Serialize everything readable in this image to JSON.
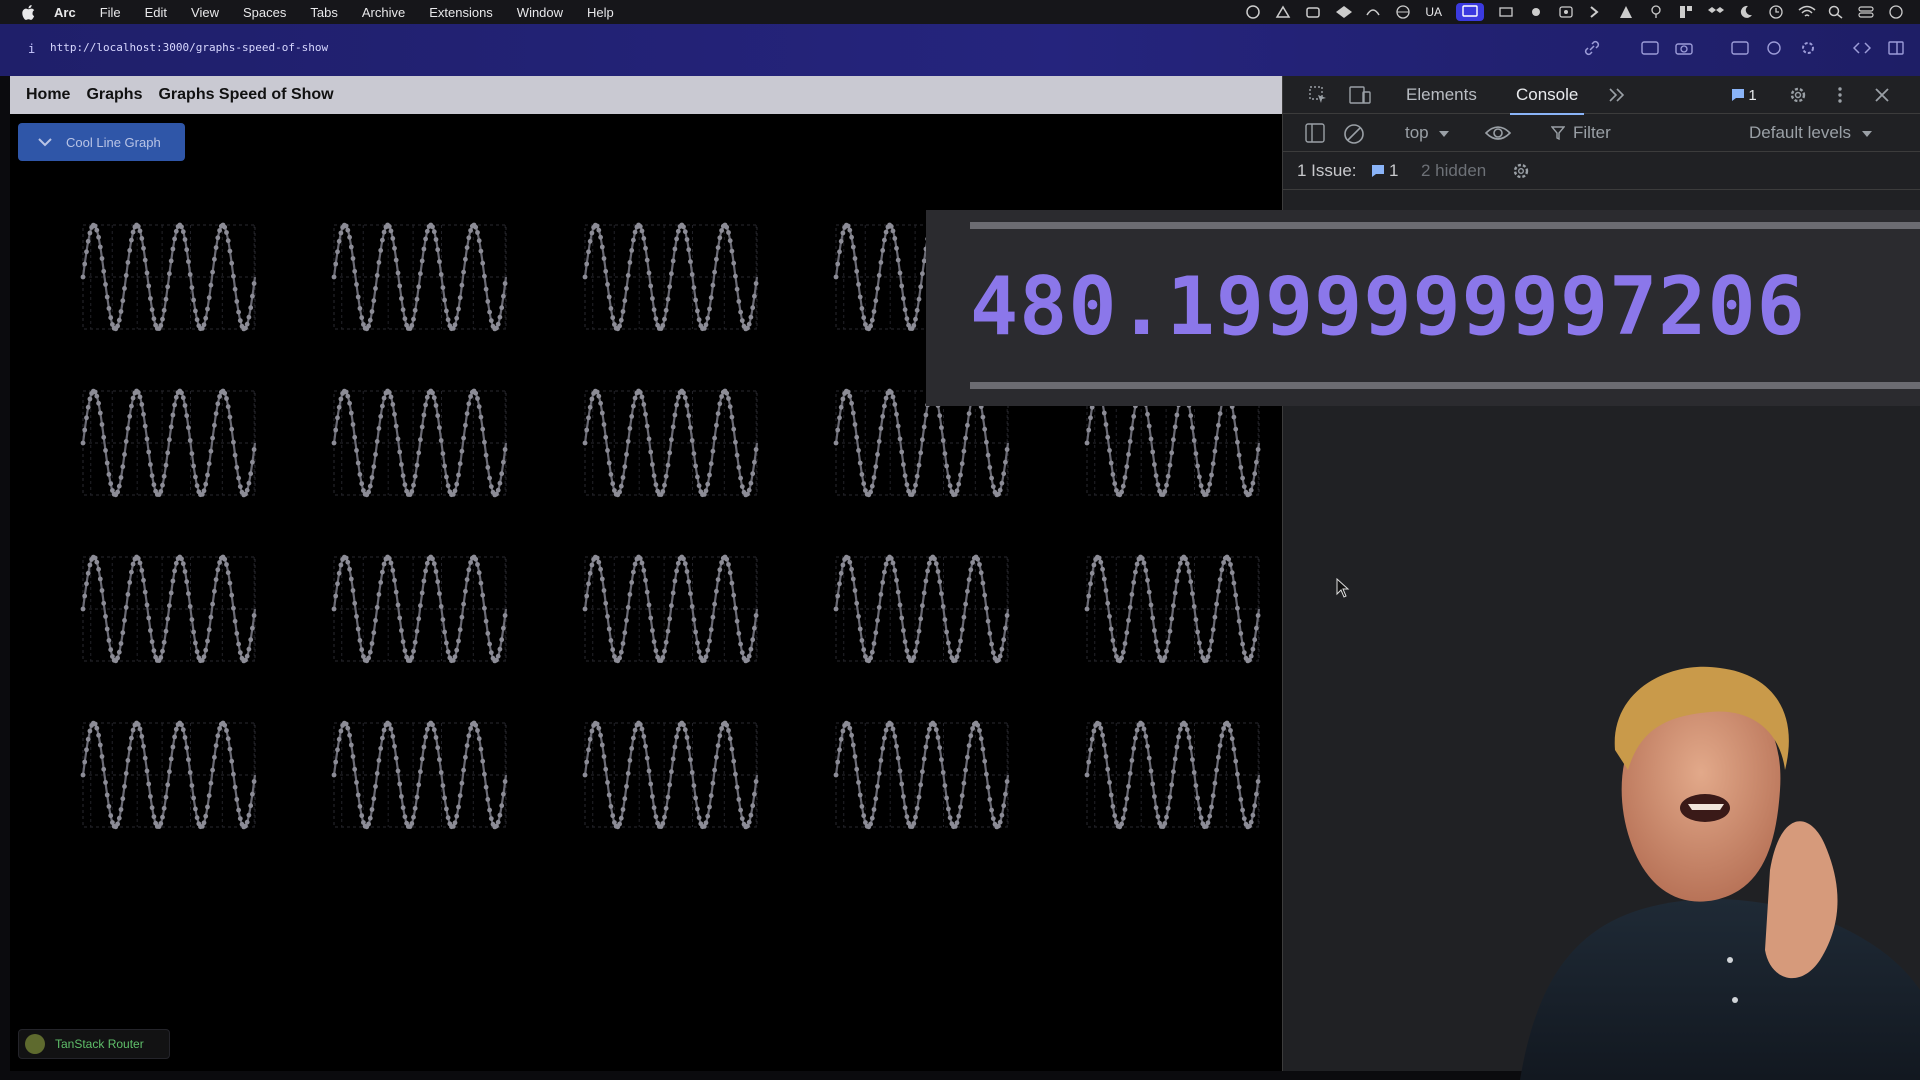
{
  "menubar": {
    "app_name": "Arc",
    "items": [
      "File",
      "Edit",
      "View",
      "Spaces",
      "Tabs",
      "Archive",
      "Extensions",
      "Window",
      "Help"
    ],
    "status_text": "UA"
  },
  "address": {
    "info": "i",
    "url": "http://localhost:3000/graphs-speed-of-show"
  },
  "page": {
    "nav": [
      "Home",
      "Graphs",
      "Graphs Speed of Show"
    ],
    "dropdown_label": "Cool Line Graph",
    "router_badge": "TanStack Router",
    "chart_grid": {
      "rows": 4,
      "cols": 5
    }
  },
  "devtools": {
    "tabs": [
      "Elements",
      "Console"
    ],
    "active_tab": "Console",
    "issues_badge": "1",
    "context": "top",
    "filter_placeholder": "Filter",
    "levels": "Default levels",
    "issues_label": "1 Issue:",
    "issues_count": "1",
    "hidden_label": "2 hidden"
  },
  "overlay": {
    "timing_value": "480.1999999997206"
  },
  "colors": {
    "accent": "#8b77ea",
    "nav_bg": "#c9c9d2",
    "dropdown_bg": "#2f56a8",
    "line_color": "#6a6a74"
  },
  "chart_data": {
    "type": "line",
    "instances": 20,
    "title": "",
    "xlabel": "",
    "ylabel": "",
    "ylim": [
      0,
      100
    ],
    "yticks": [
      0,
      50,
      100
    ],
    "xticks": [
      "9",
      "34",
      "63",
      "92",
      "125",
      "162",
      "199"
    ],
    "xlim": [
      0,
      200
    ],
    "series": [
      {
        "function": "50+50*sin(2*pi*x/50)",
        "x_start": 0,
        "x_end": 200,
        "points": 200
      }
    ],
    "grid": true,
    "legend": "none"
  }
}
